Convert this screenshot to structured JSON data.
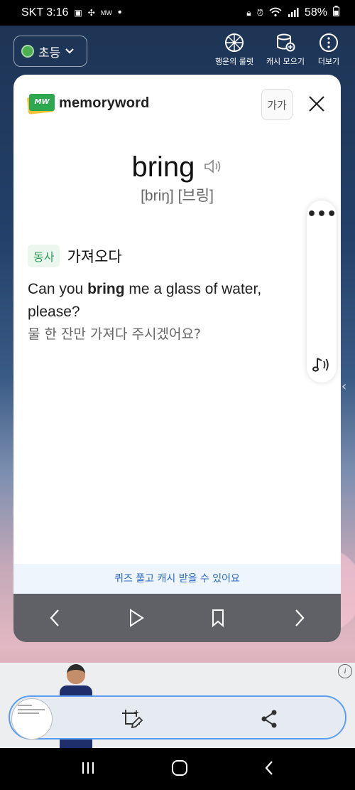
{
  "status_bar": {
    "carrier_time": "SKT 3:16",
    "dot": "•",
    "battery": "58%",
    "icons": [
      "gallery-icon",
      "pinwheel-icon",
      "memoryword-icon",
      "lock-icon",
      "alarm-icon",
      "wifi-icon",
      "signal-icon",
      "battery-icon"
    ]
  },
  "app_header": {
    "grade_label": "초등",
    "actions": [
      {
        "label": "행운의 룰렛",
        "icon": "roulette-icon"
      },
      {
        "label": "캐시 모으기",
        "icon": "coins-icon"
      },
      {
        "label": "더보기",
        "icon": "more-icon"
      }
    ]
  },
  "card": {
    "logo_text": "memoryword",
    "logo_mark": "MW",
    "font_size_button": "가가",
    "word": "bring",
    "pronunciation": "[briŋ] [브링]",
    "pos": "동사",
    "meaning": "가져오다",
    "example_en_before": "Can you ",
    "example_en_bold": "bring",
    "example_en_after": " me a glass of water, please?",
    "example_ko": "물 한 잔만 가져다 주시겠어요?",
    "side_more": "•••",
    "quiz_banner": "퀴즈 풀고 캐시 받을 수 있어요"
  },
  "colors": {
    "accent_green": "#2e9e57",
    "accent_blue": "#2b68c9",
    "nav_bar": "#5f6166"
  }
}
